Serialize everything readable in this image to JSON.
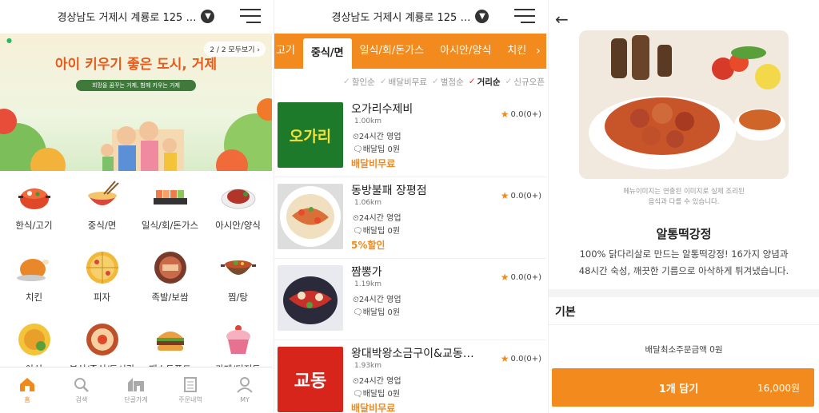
{
  "home": {
    "address": "경상남도 거제시 계룡로 125 …",
    "banner": {
      "title": "아이 키우기 좋은 도시, 거제",
      "subtitle": "희망을 꿈꾸는 거제, 함께 키우는 거제",
      "page_indicator": "2 / 2 모두보기 ›"
    },
    "categories": [
      {
        "label": "한식/고기",
        "icon": "korean-food-icon"
      },
      {
        "label": "중식/면",
        "icon": "noodle-bowl-icon"
      },
      {
        "label": "일식/회/돈가스",
        "icon": "sushi-icon"
      },
      {
        "label": "아시안/양식",
        "icon": "steak-icon"
      },
      {
        "label": "치킨",
        "icon": "chicken-icon"
      },
      {
        "label": "피자",
        "icon": "pizza-icon"
      },
      {
        "label": "족발/보쌈",
        "icon": "jokbal-icon"
      },
      {
        "label": "찜/탕",
        "icon": "stew-pot-icon"
      },
      {
        "label": "야식",
        "icon": "late-night-icon"
      },
      {
        "label": "분식/중식/도시락",
        "icon": "snack-icon"
      },
      {
        "label": "패스트푸드",
        "icon": "burger-icon"
      },
      {
        "label": "카페/디저트",
        "icon": "cupcake-icon"
      }
    ],
    "nav": [
      {
        "label": "홈",
        "icon": "home-icon",
        "active": true
      },
      {
        "label": "검색",
        "icon": "search-icon"
      },
      {
        "label": "단골가게",
        "icon": "store-icon"
      },
      {
        "label": "주문내역",
        "icon": "order-list-icon"
      },
      {
        "label": "MY",
        "icon": "user-icon"
      }
    ]
  },
  "list": {
    "address": "경상남도 거제시 계룡로 125 …",
    "tabs": [
      {
        "label": "고기"
      },
      {
        "label": "중식/면",
        "active": true
      },
      {
        "label": "일식/회/돈가스"
      },
      {
        "label": "아시안/양식"
      },
      {
        "label": "치킨"
      }
    ],
    "sorts": [
      {
        "label": "할인순"
      },
      {
        "label": "배달비무료"
      },
      {
        "label": "별점순"
      },
      {
        "label": "거리순",
        "active": true
      },
      {
        "label": "신규오픈"
      }
    ],
    "restaurants": [
      {
        "name": "오가리수제비",
        "distance": "1.00km",
        "hours": "24시간 영업",
        "tip": "배달팁 0원",
        "promo": "배달비무료",
        "rating": "0.0(0+)",
        "logo_text": "오가리"
      },
      {
        "name": "동방불패 장평점",
        "distance": "1.06km",
        "hours": "24시간 영업",
        "tip": "배달팁 0원",
        "promo": "5%할인",
        "rating": "0.0(0+)"
      },
      {
        "name": "짬뽕가",
        "distance": "1.19km",
        "hours": "24시간 영업",
        "tip": "배달팁 0원",
        "promo": "",
        "rating": "0.0(0+)"
      },
      {
        "name": "왕대박왕소금구이&교동…",
        "distance": "1.93km",
        "hours": "24시간 영업",
        "tip": "배달팁 0원",
        "promo": "배달비무료",
        "rating": "0.0(0+)",
        "logo_text": "교동"
      }
    ]
  },
  "detail": {
    "disclaimer_line1": "메뉴이미지는 연출된 이미지로 실제 조리된",
    "disclaimer_line2": "음식과 다를 수 있습니다.",
    "dish_name": "알통떡강정",
    "desc_line1": "100% 닭다리살로 만드는 알통떡강정! 16가지 양념과",
    "desc_line2": "48시간 숙성, 깨끗한 기름으로 아삭하게 튀겨냈습니다.",
    "option_title": "기본",
    "min_order": "배달최소주문금액 0원",
    "cart_label": "1개 담기",
    "cart_price": "16,000원"
  },
  "colors": {
    "accent": "#f38a1e",
    "promo": "#f08a1c"
  }
}
